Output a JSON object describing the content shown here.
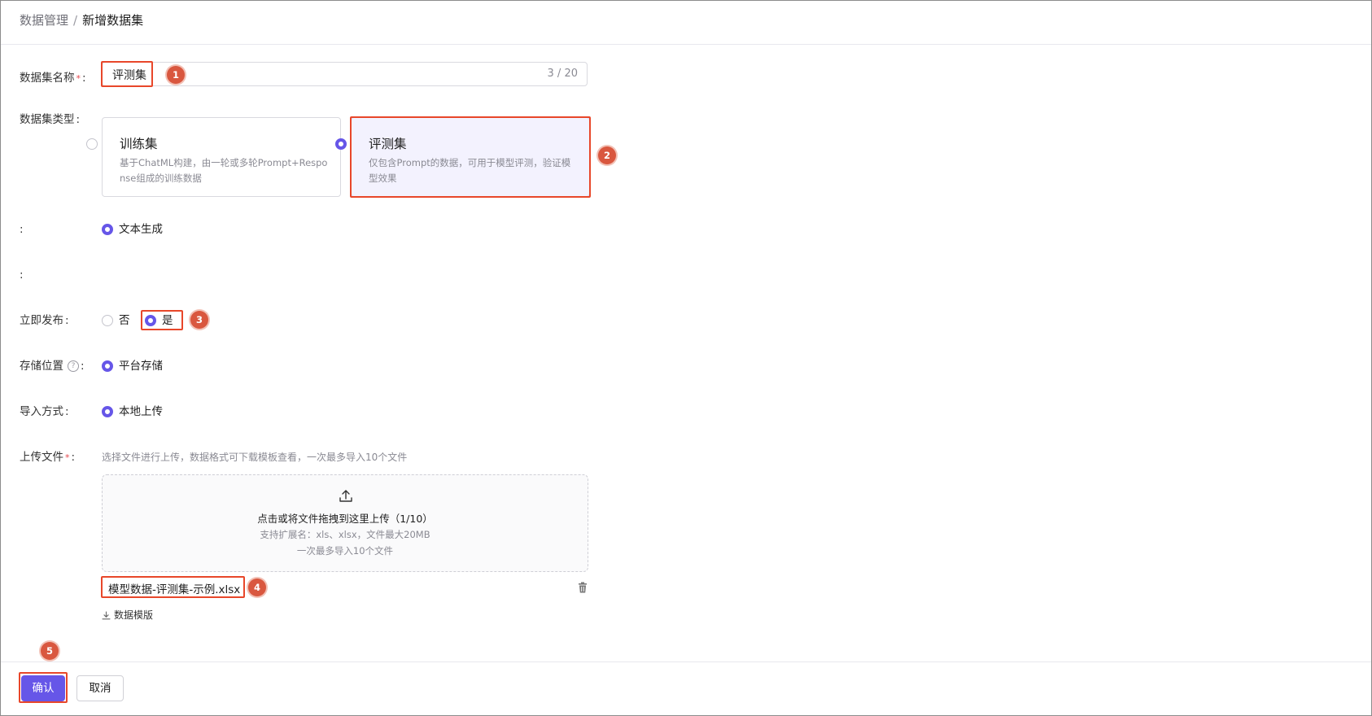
{
  "breadcrumb": {
    "parent": "数据管理",
    "separator": "/",
    "current": "新增数据集"
  },
  "form": {
    "name": {
      "label": "数据集名称",
      "required_mark": "*",
      "value": "评测集",
      "count": "3 / 20"
    },
    "type": {
      "label": "数据集类型",
      "options": [
        {
          "title": "训练集",
          "desc": "基于ChatML构建，由一轮或多轮Prompt+Response组成的训练数据",
          "selected": false
        },
        {
          "title": "评测集",
          "desc": "仅包含Prompt的数据，可用于模型评测，验证模型效果",
          "selected": true
        }
      ]
    },
    "empty_label_1": ":",
    "generation": {
      "option": "文本生成"
    },
    "empty_label_2": ":",
    "publish": {
      "label": "立即发布",
      "options": [
        "否",
        "是"
      ],
      "selected": "是"
    },
    "storage": {
      "label": "存储位置",
      "help_icon": "question-circle-icon",
      "option": "平台存储"
    },
    "import": {
      "label": "导入方式",
      "option": "本地上传"
    },
    "upload": {
      "label": "上传文件",
      "required_mark": "*",
      "hint": "选择文件进行上传，数据格式可下载模板查看，一次最多导入10个文件",
      "drop_text": "点击或将文件拖拽到这里上传（1/10）",
      "ext_text": "支持扩展名：xls、xlsx，文件最大20MB",
      "limit_text": "一次最多导入10个文件",
      "file_name": "模型数据-评测集-示例.xlsx",
      "template_link": "数据模版"
    }
  },
  "annotations": [
    "1",
    "2",
    "3",
    "4",
    "5"
  ],
  "footer": {
    "confirm": "确认",
    "cancel": "取消"
  },
  "colors": {
    "accent": "#6656e8",
    "highlight": "#e8472a",
    "badge": "#d9573f"
  }
}
